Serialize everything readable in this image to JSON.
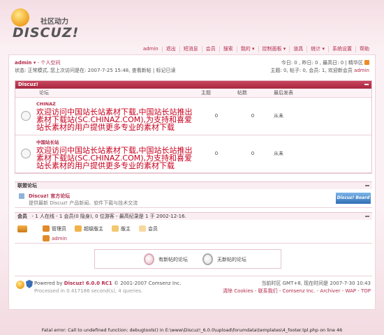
{
  "logo": {
    "brand": "DISCUZ!",
    "tagline": "社区动力"
  },
  "nav": [
    "admin",
    "退出",
    "短消息",
    "会员",
    "搜索",
    "我的 ▾",
    "控制面板 ▾",
    "道具",
    "统计 ▾",
    "系统设置",
    "帮助"
  ],
  "user": {
    "name": "admin ▾",
    "space": "- 个人空间",
    "status_line": "状态: 正常模式, 您上次访问是在: 2007-7-25 15:48, 查看新帖 | 标记已读"
  },
  "stats": {
    "line1": "今日: 0 , 昨日: 0 , 最高日: 0 | 精华区",
    "line2": "主题: 0, 帖子: 0, 会员: 1, 欢迎新会员"
  },
  "stats_welcome_user": "admin",
  "main_section": {
    "title": "Discuz!",
    "columns": [
      "论坛",
      "主题",
      "帖数",
      "最后发表"
    ],
    "rows": [
      {
        "name": "CHINAZ",
        "desc": "欢迎访问中国站长站素材下载,中国站长站推出素材下载站(SC.CHINAZ.COM),为支持和喜爱站长素材的用户提供更多专业的素材下载",
        "topics": "0",
        "posts": "0",
        "last": "从未"
      },
      {
        "name": "中国站长站",
        "desc": "欢迎访问中国站长站素材下载,中国站长站推出素材下载站(SC.CHINAZ.COM),为支持和喜爱站长素材的用户提供更多专业的素材下载",
        "topics": "0",
        "posts": "0",
        "last": "从未"
      }
    ]
  },
  "links_section": {
    "title": "联盟论坛",
    "name": "Discuz! 官方论坛",
    "desc": "提供最新 Discuz! 产品新闻、软件下载与技术交流",
    "banner": "Discuz! Board"
  },
  "online_section": {
    "title": "会员",
    "summary": "- 1 人在线 - 1 会员(0 隐身), 0 位游客 - 最高纪录是 1 于 2002-12-16.",
    "legend": [
      "管理员",
      "超级版主",
      "版主",
      "会员"
    ],
    "online_user": "admin"
  },
  "legend_box": {
    "new": "有新帖的论坛",
    "none": "无新帖的论坛"
  },
  "footer": {
    "powered_prefix": "Powered by ",
    "powered_product": "Discuz! 6.0.0 RC1",
    "powered_suffix": " © 2001-2007 Comsenz Inc.",
    "processed": "Processed in 0.417186 second(s), 4 queries.",
    "time": "当前时区 GMT+8, 现在时间是 2007-7-30 10:43",
    "links": "清除 Cookies - 联系我们 - Comsenz Inc. - Archiver - WAP - TOP"
  },
  "fatal_error": "Fatal error: Call to undefined function: debugtools() in E:\\www\\Discuz!_6.0.0\\upload\\forumdata\\templates\\4_footer.tpl.php on line 46",
  "colors": {
    "accent": "#b22a4a",
    "header_bar": "#a8263f",
    "desc_red": "#c8001e"
  }
}
